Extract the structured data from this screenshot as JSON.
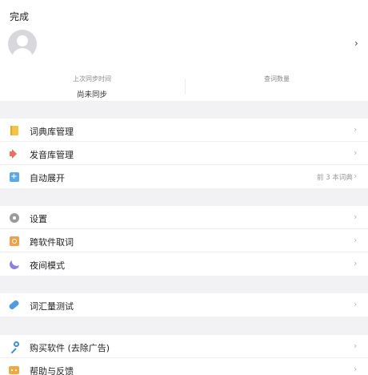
{
  "header": {
    "done_label": "完成"
  },
  "profile": {
    "chevron": "›"
  },
  "stats": {
    "sync_label": "上次同步时间",
    "sync_value": "尚未同步",
    "words_label": "查词数量",
    "words_value": ""
  },
  "groups": [
    {
      "items": [
        {
          "label": "词典库管理",
          "icon": "dictionary-icon",
          "hint": ""
        },
        {
          "label": "发音库管理",
          "icon": "speaker-icon",
          "hint": ""
        },
        {
          "label": "自动展开",
          "icon": "expand-icon",
          "hint": "前 3 本词典"
        }
      ]
    },
    {
      "items": [
        {
          "label": "设置",
          "icon": "gear-icon",
          "hint": ""
        },
        {
          "label": "跨软件取词",
          "icon": "cross-app-lookup-icon",
          "hint": ""
        },
        {
          "label": "夜间模式",
          "icon": "moon-icon",
          "hint": ""
        }
      ]
    },
    {
      "items": [
        {
          "label": "词汇量测试",
          "icon": "vocabulary-test-icon",
          "hint": ""
        }
      ]
    },
    {
      "items": [
        {
          "label": "购买软件 (去除广告)",
          "icon": "key-icon",
          "hint": ""
        },
        {
          "label": "帮助与反馈",
          "icon": "feedback-icon",
          "hint": ""
        }
      ]
    }
  ],
  "chevron": "›"
}
